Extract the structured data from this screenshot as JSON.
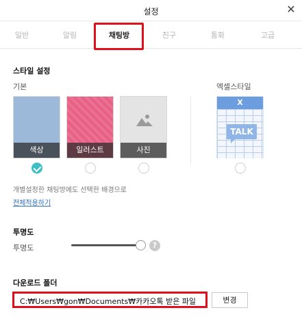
{
  "window": {
    "title": "설정",
    "close_icon": "close-icon"
  },
  "tabs": [
    {
      "label": "일반",
      "active": false
    },
    {
      "label": "알림",
      "active": false
    },
    {
      "label": "채팅방",
      "active": true
    },
    {
      "label": "친구",
      "active": false
    },
    {
      "label": "통화",
      "active": false
    },
    {
      "label": "고급",
      "active": false
    }
  ],
  "style_settings": {
    "title": "스타일 설정",
    "basic_label": "기본",
    "excel_label": "엑셀스타일",
    "options": [
      {
        "caption": "색상",
        "selected": true,
        "color": "#9db9d9"
      },
      {
        "caption": "일러스트",
        "selected": false,
        "color": "#e8678a"
      },
      {
        "caption": "사진",
        "selected": false,
        "icon": "image-icon"
      }
    ],
    "excel_option": {
      "header": "X",
      "bubble_text": "TALK",
      "selected": false
    },
    "description": "개별설정한 채팅방에도 선택한 배경으로",
    "apply_all_link": "전체적용하기"
  },
  "transparency": {
    "title": "투명도",
    "label": "투명도",
    "value_fraction": 1.0,
    "help_icon": "help-icon",
    "help_text": "?"
  },
  "download_folder": {
    "title": "다운로드 폴더",
    "path": "C:₩Users₩gon₩Documents₩카카오톡 받은 파일",
    "change_button": "변경"
  },
  "colors": {
    "accent": "#3fbfc5",
    "highlight": "#e0101b",
    "link": "#2f6fbe"
  }
}
